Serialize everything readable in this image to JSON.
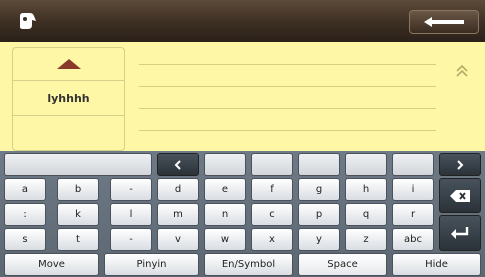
{
  "candidates": {
    "word": "lyhhhh"
  },
  "keyboard": {
    "rows": [
      [
        "a",
        "b",
        "-",
        "d",
        "e",
        "f",
        "g",
        "h",
        "i"
      ],
      [
        ":",
        "k",
        "l",
        "m",
        "n",
        "c",
        "p",
        "q",
        "r"
      ],
      [
        "s",
        "t",
        "-",
        "v",
        "w",
        "x",
        "y",
        "z",
        "abc"
      ]
    ],
    "bottom": {
      "move": "Move",
      "pinyin": "Pinyin",
      "en_symbol": "En/Symbol",
      "space": "Space",
      "hide": "Hide"
    }
  },
  "icons": {
    "logo": "hand-logo-icon",
    "back": "left-arrow-icon",
    "up": "triangle-up-icon",
    "collapse": "double-chevron-up-icon",
    "prev": "chevron-left-icon",
    "next": "chevron-right-icon",
    "delete": "backspace-icon",
    "enter": "enter-icon"
  },
  "colors": {
    "note_bg": "#fdf7a6",
    "topbar": "#3c2e22",
    "keyboard": "#626d78",
    "accent_red": "#8a3a2a"
  }
}
